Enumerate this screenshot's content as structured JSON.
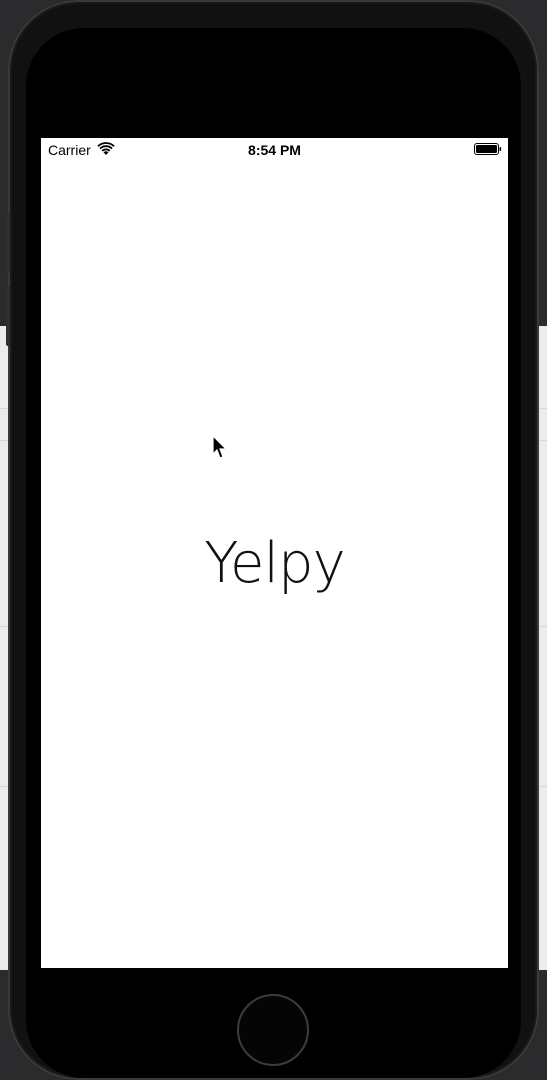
{
  "status_bar": {
    "carrier": "Carrier",
    "time": "8:54 PM"
  },
  "app": {
    "title": "Yelpy"
  },
  "icons": [
    "wifi-icon",
    "battery-icon",
    "cursor-icon",
    "home-button"
  ],
  "colors": {
    "screen_background": "#ffffff",
    "device_body": "#000000",
    "text": "#111111"
  }
}
